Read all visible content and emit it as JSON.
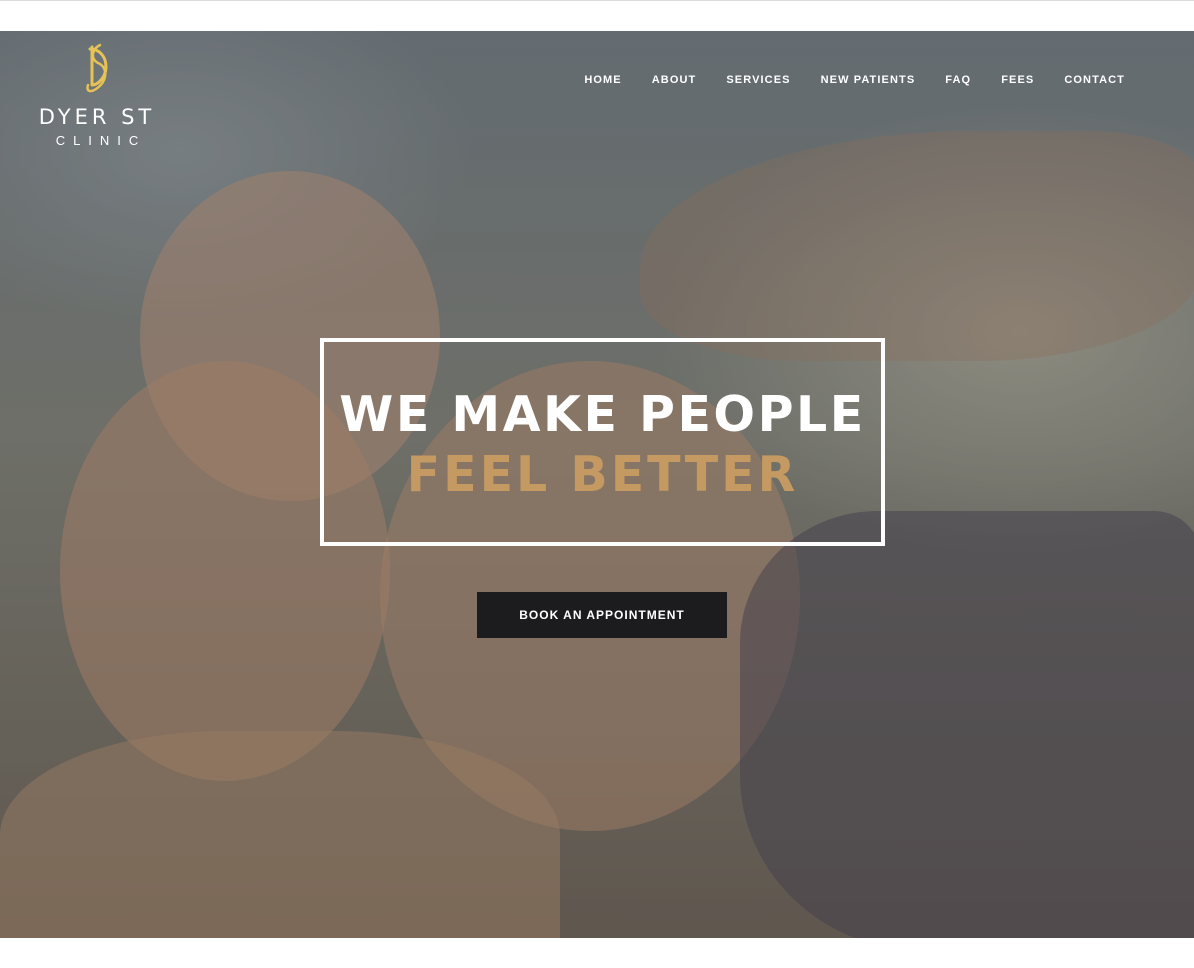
{
  "header": {
    "logo_line1": "DYER ST",
    "logo_line2": "CLINIC",
    "logo_mark_color": "#e7c255"
  },
  "nav": {
    "items": [
      {
        "label": "HOME"
      },
      {
        "label": "ABOUT"
      },
      {
        "label": "SERVICES"
      },
      {
        "label": "NEW PATIENTS"
      },
      {
        "label": "FAQ"
      },
      {
        "label": "FEES"
      },
      {
        "label": "CONTACT"
      }
    ]
  },
  "hero": {
    "headline_line1": "WE MAKE PEOPLE",
    "headline_line2": "FEEL BETTER",
    "accent_color": "#c49a62",
    "cta_label": "BOOK AN APPOINTMENT"
  }
}
